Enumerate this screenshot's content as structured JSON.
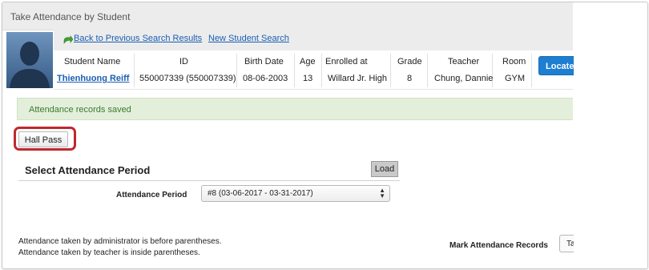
{
  "window": {
    "title": "Take Attendance by Student"
  },
  "links": {
    "back": "Back to Previous Search Results",
    "new_search": "New Student Search"
  },
  "student": {
    "headers": {
      "name": "Student Name",
      "id": "ID",
      "birth_date": "Birth Date",
      "age": "Age",
      "enrolled_at": "Enrolled at",
      "grade": "Grade",
      "teacher": "Teacher",
      "room": "Room"
    },
    "values": {
      "name": "Thienhuong Reiff",
      "id": "550007339 (550007339)",
      "birth_date": "08-06-2003",
      "age": "13",
      "enrolled_at": "Willard Jr. High",
      "grade": "8",
      "teacher": "Chung, Dannie",
      "room": "GYM"
    },
    "locate_button": "Locate C"
  },
  "alert": {
    "message": "Attendance records saved"
  },
  "hall_pass": {
    "label": "Hall Pass"
  },
  "period_section": {
    "title": "Select Attendance Period",
    "load_label": "Load",
    "period_label": "Attendance Period",
    "period_value": "#8 (03-06-2017 - 03-31-2017)"
  },
  "notes": {
    "line1": "Attendance taken by administrator is before parentheses.",
    "line2": "Attendance taken by teacher is inside parentheses."
  },
  "mark_records": {
    "label": "Mark Attendance Records",
    "value": "Ta"
  },
  "icons": {
    "back": "green-back-arrow-icon",
    "avatar": "student-photo-placeholder",
    "select_arrows": "up-down-arrows-icon"
  },
  "colors": {
    "link": "#1a5fb4",
    "primary_button": "#1d7fd1",
    "alert_bg": "#e3efdb",
    "alert_text": "#3c7a30",
    "highlight": "#c0282d"
  }
}
